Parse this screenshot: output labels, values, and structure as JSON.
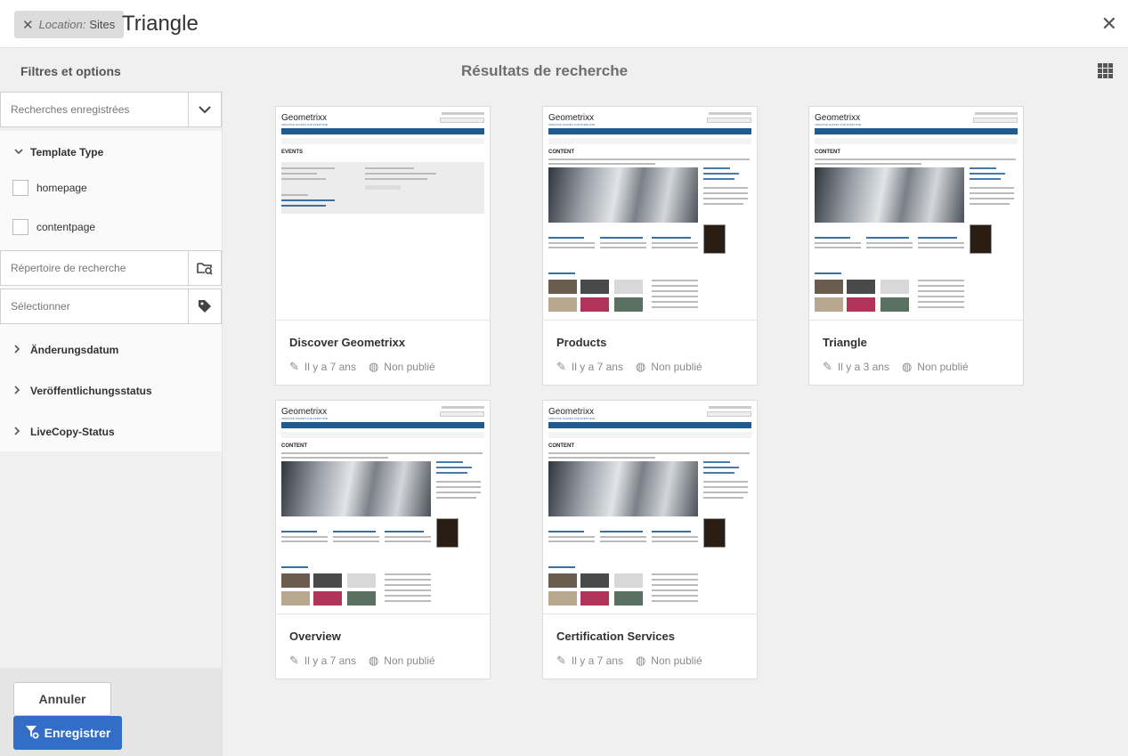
{
  "topbar": {
    "location_key": "Location:",
    "location_value": "Sites",
    "search_text": "Triangle"
  },
  "subbar": {
    "filters_title": "Filtres et options",
    "results_title": "Résultats de recherche"
  },
  "rail": {
    "saved_searches_placeholder": "Recherches enregistrées",
    "template_type_label": "Template Type",
    "checkboxes": [
      {
        "label": "homepage"
      },
      {
        "label": "contentpage"
      }
    ],
    "search_dir_placeholder": "Répertoire de recherche",
    "select_placeholder": "Sélectionner",
    "accordions": [
      {
        "label": "Änderungsdatum"
      },
      {
        "label": "Veröffentlichungsstatus"
      },
      {
        "label": "LiveCopy-Status"
      }
    ],
    "cancel_label": "Annuler",
    "save_label": "Enregistrer"
  },
  "thumb_text": {
    "logo": "Geometrixx",
    "tagline": "CREATIVE SHAPES FOR EVERYONE",
    "events_heading": "EVENTS",
    "content_heading": "CONTENT"
  },
  "cards": [
    {
      "title": "Discover Geometrixx",
      "modified": "Il y a 7 ans",
      "status": "Non publié",
      "thumb": "events"
    },
    {
      "title": "Products",
      "modified": "Il y a 7 ans",
      "status": "Non publié",
      "thumb": "content"
    },
    {
      "title": "Triangle",
      "modified": "Il y a 3 ans",
      "status": "Non publié",
      "thumb": "content"
    },
    {
      "title": "Overview",
      "modified": "Il y a 7 ans",
      "status": "Non publié",
      "thumb": "content"
    },
    {
      "title": "Certification Services",
      "modified": "Il y a 7 ans",
      "status": "Non publié",
      "thumb": "content"
    }
  ]
}
